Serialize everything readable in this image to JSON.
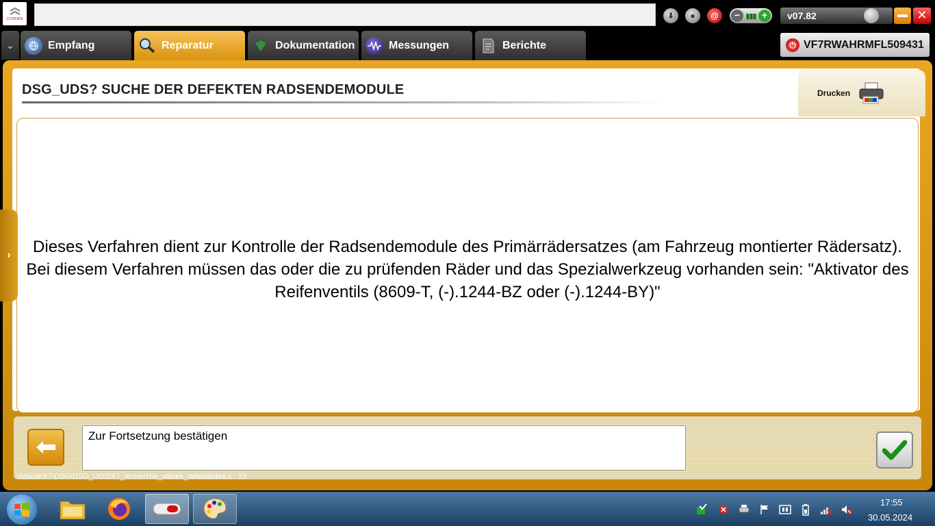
{
  "topbar": {
    "brand": "CITROËN",
    "version": "v07.82",
    "icons": [
      "download-icon",
      "user-icon",
      "at-icon",
      "connection-icon",
      "minimize-icon",
      "close-icon"
    ]
  },
  "tabs": [
    {
      "label": "Empfang",
      "icon": "globe-icon",
      "active": false
    },
    {
      "label": "Reparatur",
      "icon": "magnifier-icon",
      "active": true
    },
    {
      "label": "Dokumentation",
      "icon": "book-icon",
      "active": false
    },
    {
      "label": "Messungen",
      "icon": "waveform-icon",
      "active": false
    },
    {
      "label": "Berichte",
      "icon": "report-icon",
      "active": false
    }
  ],
  "vin": "VF7RWAHRMFL509431",
  "procedure": {
    "title": "DSG_UDS?  SUCHE DER DEFEKTEN RADSENDEMODULE",
    "print_label": "Drucken",
    "message": "Dieses Verfahren dient zur Kontrolle der Radsendemodule des Primärrädersatzes (am Fahrzeug montierter Rädersatz). Bei diesem Verfahren müssen das oder die zu prüfenden Räder und das Spezialwerkzeug vorhanden sein: \"Aktivator des Reifenventils (8609-T, (-).1244-BZ oder (-).1244-BY)\""
  },
  "bottom": {
    "prompt": "Zur Fortsetzung bestätigen",
    "path": "Vehicle\\X7\\DSG\\DSG_UDS\\X7_recherche_valves_defaillantes.s : 13"
  },
  "taskbar": {
    "time": "17:55",
    "date": "30.05.2024"
  },
  "colors": {
    "accent": "#e8a623",
    "tab_active": "#f0b53a",
    "taskbar": "#2b5a86"
  }
}
